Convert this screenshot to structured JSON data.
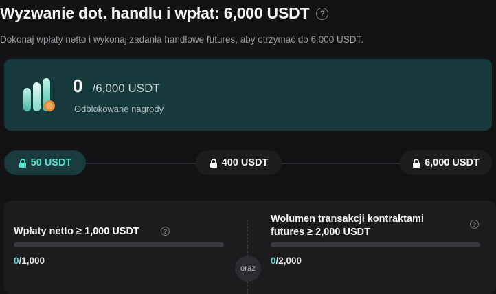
{
  "header": {
    "title": "Wyzwanie dot. handlu i wpłat: 6,000 USDT",
    "subtitle": "Dokonaj wpłaty netto i wykonaj zadania handlowe futures, aby otrzymać do 6,000 USDT."
  },
  "reward": {
    "current": "0",
    "total": "/6,000 USDT",
    "label": "Odblokowane nagrody"
  },
  "milestones": [
    {
      "label": "50 USDT",
      "active": true
    },
    {
      "label": "400 USDT",
      "active": false
    },
    {
      "label": "6,000 USDT",
      "active": false
    }
  ],
  "tasks": [
    {
      "title": "Wpłaty netto ≥ 1,000 USDT",
      "progress_current": "0",
      "progress_total": "/1,000",
      "fraction": 0
    },
    {
      "title_line1": "Wolumen transakcji kontraktami",
      "title_line2": "futures ≥ 2,000 USDT",
      "progress_current": "0",
      "progress_total": "/2,000",
      "fraction": 0
    }
  ],
  "connector": "oraz",
  "icons": {
    "help": "question-circle-icon",
    "lock": "lock-icon",
    "reward": "bar-chart-coin-icon"
  },
  "colors": {
    "accent": "#4fe3cc",
    "card": "#173a3d",
    "background": "#131315"
  }
}
